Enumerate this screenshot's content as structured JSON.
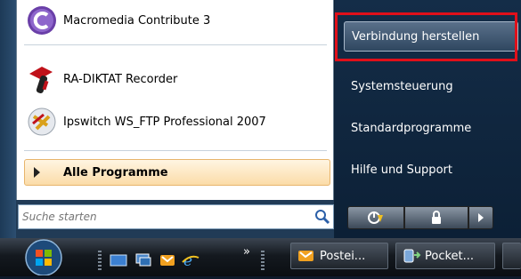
{
  "start_menu": {
    "programs": [
      {
        "label": "Macromedia Contribute 3",
        "icon": "contribute-icon"
      },
      {
        "label": "RA-DIKTAT Recorder",
        "icon": "dictation-recorder-icon"
      },
      {
        "label": "Ipswitch WS_FTP Professional 2007",
        "icon": "ftp-client-icon"
      }
    ],
    "all_programs_label": "Alle Programme",
    "search_placeholder": "Suche starten",
    "right_items": [
      {
        "label": "Verbindung herstellen"
      },
      {
        "label": "Systemsteuerung"
      },
      {
        "label": "Standardprogramme"
      },
      {
        "label": "Hilfe und Support"
      }
    ],
    "highlight_color": "#e0101a"
  },
  "taskbar": {
    "buttons": [
      {
        "label": "Postei...",
        "icon": "outlook-folder-icon"
      },
      {
        "label": "Pocket...",
        "icon": "pocket-device-icon"
      }
    ],
    "overflow_glyph": "»"
  }
}
